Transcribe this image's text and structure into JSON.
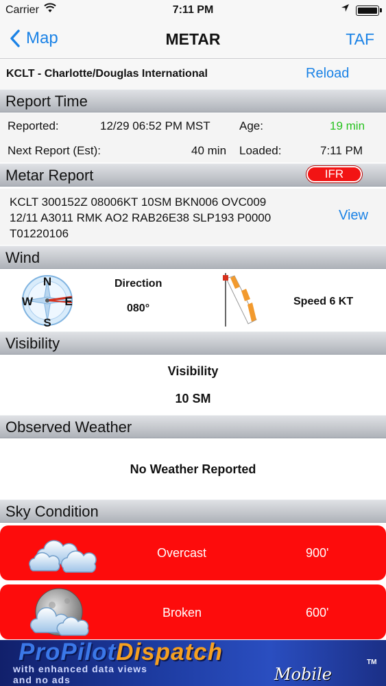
{
  "status_bar": {
    "carrier": "Carrier",
    "time": "7:11 PM"
  },
  "nav": {
    "back_label": "Map",
    "title": "METAR",
    "right_label": "TAF"
  },
  "station": {
    "name": "KCLT - Charlotte/Douglas International",
    "reload_label": "Reload"
  },
  "report_time": {
    "header": "Report Time",
    "reported_label": "Reported:",
    "reported_value": "12/29 06:52 PM MST",
    "age_label": "Age:",
    "age_value": "19 min",
    "next_label": "Next Report (Est):",
    "next_value": "40 min",
    "loaded_label": "Loaded:",
    "loaded_value": "7:11 PM",
    "age_color": "#27c21f"
  },
  "metar_report": {
    "header": "Metar Report",
    "flight_category": "IFR",
    "lines": [
      "KCLT 300152Z 08006KT 10SM BKN006 OVC009",
      "12/11 A3011 RMK AO2 RAB26E38 SLP193 P0000",
      "T01220106"
    ],
    "view_label": "View"
  },
  "wind": {
    "header": "Wind",
    "direction_label": "Direction",
    "direction_value": "080°",
    "speed_value": "Speed 6 KT",
    "compass_letters": [
      "N",
      "W",
      "E",
      "S"
    ]
  },
  "visibility": {
    "header": "Visibility",
    "label": "Visibility",
    "value": "10 SM"
  },
  "observed_weather": {
    "header": "Observed Weather",
    "value": "No Weather Reported"
  },
  "sky_condition": {
    "header": "Sky Condition",
    "layers": [
      {
        "condition": "Overcast",
        "altitude": "900'",
        "icon": "overcast-cloud-icon"
      },
      {
        "condition": "Broken",
        "altitude": "600'",
        "icon": "broken-cloud-moon-icon"
      }
    ],
    "card_color": "#fd0c0c"
  },
  "ad": {
    "brand_part1": "ProPilot",
    "brand_part2": "Dispatch",
    "tagline_line1": "with enhanced data views",
    "tagline_line2": "and no ads",
    "mobile": "Mobile",
    "trademark": "TM"
  },
  "colors": {
    "accent": "#1a82e6",
    "ifr": "#f21414"
  }
}
